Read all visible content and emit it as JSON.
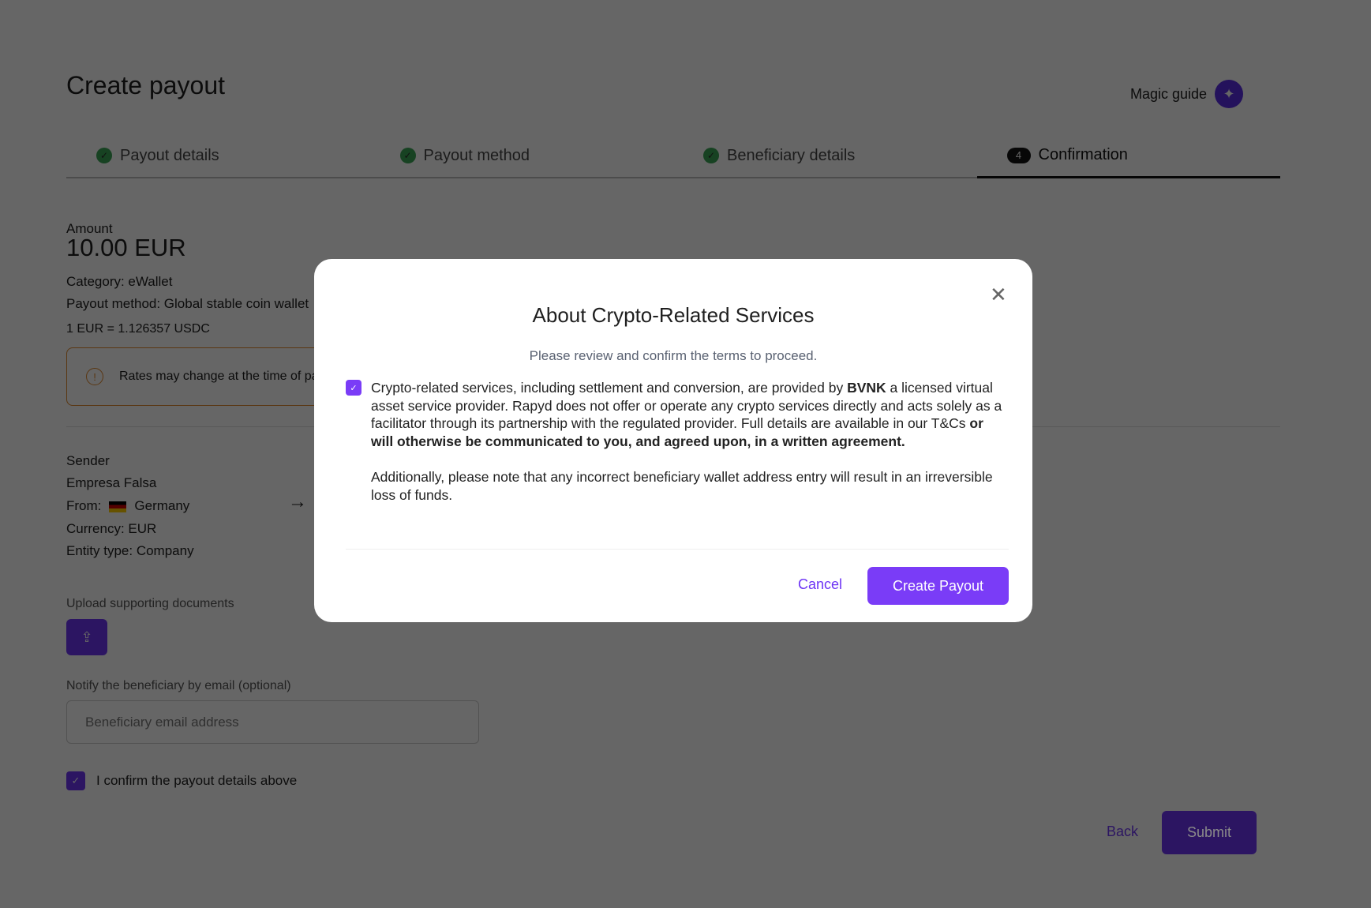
{
  "page": {
    "title": "Create payout",
    "magic_guide": "Magic guide"
  },
  "steps": [
    {
      "label": "Payout details"
    },
    {
      "label": "Payout method"
    },
    {
      "label": "Beneficiary details"
    },
    {
      "label": "Confirmation",
      "number": "4"
    }
  ],
  "summary": {
    "amount_label": "Amount",
    "amount": "10.00 EUR",
    "category": "Category: eWallet",
    "method": "Payout method: Global stable coin wallet",
    "rate": "1 EUR = 1.126357 USDC",
    "warning": "Rates may change at the time of payout"
  },
  "sender": {
    "heading": "Sender",
    "name": "Empresa Falsa",
    "from_label": "From:",
    "country": "Germany",
    "currency": "Currency: EUR",
    "entity": "Entity type: Company"
  },
  "upload": {
    "label": "Upload supporting documents"
  },
  "notify": {
    "label": "Notify the beneficiary by email (optional)",
    "placeholder": "Beneficiary email address",
    "value": ""
  },
  "confirm": {
    "label": "I confirm the payout details above",
    "checked": true
  },
  "actions": {
    "back": "Back",
    "submit": "Submit"
  },
  "modal": {
    "title": "About Crypto-Related Services",
    "subtitle": "Please review and confirm the terms to proceed.",
    "p1a": "Crypto-related services, including settlement and conversion, are provided by ",
    "p1b": "BVNK",
    "p1c": " a licensed virtual asset service provider. Rapyd does not offer or operate any crypto services directly and acts solely as a facilitator through its partnership with the regulated provider. Full details are available in our T&Cs ",
    "p1d": "or will otherwise be communicated to you, and agreed upon, in a written agreement.",
    "p2": "Additionally, please note that any incorrect beneficiary wallet address entry will result in an irreversible loss of funds.",
    "cancel": "Cancel",
    "create": "Create Payout",
    "checked": true
  },
  "colors": {
    "accent": "#7a3cf7",
    "success": "#3aa655",
    "warning": "#e08a2c"
  }
}
